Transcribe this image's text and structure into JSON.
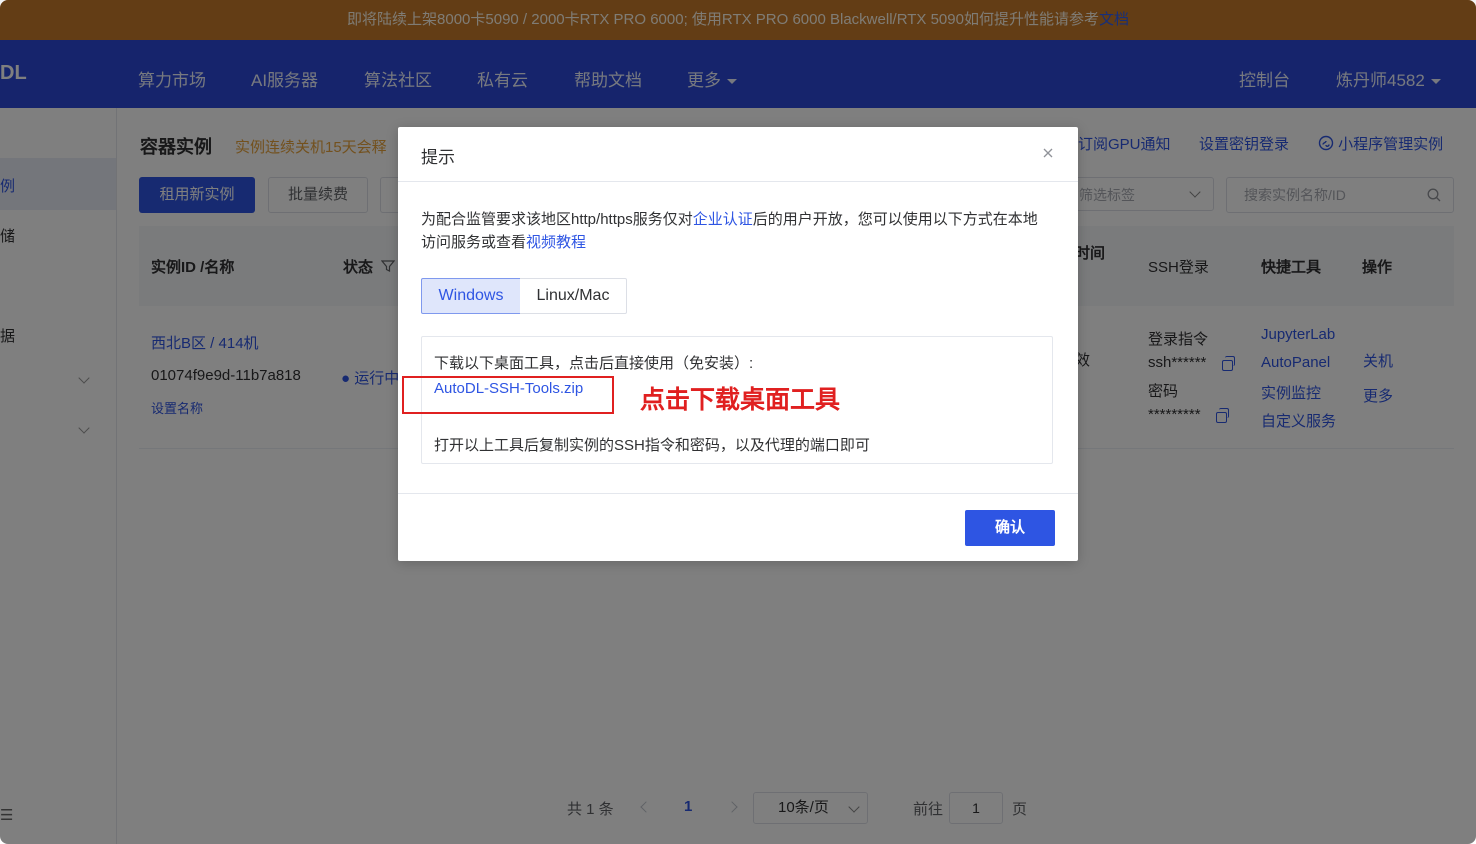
{
  "banner": {
    "text": "即将陆续上架8000卡5090 / 2000卡RTX PRO 6000; 使用RTX PRO 6000 Blackwell/RTX 5090如何提升性能请参考",
    "link": "文档"
  },
  "nav": {
    "logo": "DL",
    "items": [
      "算力市场",
      "AI服务器",
      "算法社区",
      "私有云",
      "帮助文档",
      "更多"
    ],
    "console": "控制台",
    "user": "炼丹师4582"
  },
  "sidebar": {
    "items": [
      "例",
      "储",
      "据",
      "☰"
    ]
  },
  "page": {
    "title": "容器实例",
    "note": "实例连续关机15天会释",
    "rent_button": "租用新实例",
    "renew_button": "批量续费",
    "subscribe_link": "订阅GPU通知",
    "key_link": "设置密钥登录",
    "miniprogram_link": "小程序管理实例",
    "filter_placeholder": "筛选标签",
    "search_placeholder": "搜索实例名称/ID"
  },
  "table": {
    "headers": {
      "id": "实例ID /名称",
      "status": "状态",
      "time": "时间",
      "ssh": "SSH登录",
      "tools": "快捷工具",
      "ops": "操作"
    },
    "row": {
      "region": "西北B区 / 414机",
      "id": "01074f9e9d-11b7a818",
      "set_name": "设置名称",
      "status": "运行中",
      "time_frag": "效",
      "ssh_cmd_label": "登录指令",
      "ssh_cmd": "ssh******",
      "pwd_label": "密码",
      "pwd": "*********",
      "tools": [
        "JupyterLab",
        "AutoPanel",
        "实例监控",
        "自定义服务"
      ],
      "ops": [
        "关机",
        "更多"
      ]
    }
  },
  "pagination": {
    "total": "共 1 条",
    "current": "1",
    "per_page": "10条/页",
    "goto_label": "前往",
    "goto_value": "1",
    "page_unit": "页"
  },
  "modal": {
    "title": "提示",
    "desc_before": "为配合监管要求该地区http/https服务仅对",
    "desc_link1": "企业认证",
    "desc_mid": "后的用户开放，您可以使用以下方式在本地访问服务或查看",
    "desc_link2": "视频教程",
    "tabs": [
      "Windows",
      "Linux/Mac"
    ],
    "line1": "下载以下桌面工具，点击后直接使用（免安装）:",
    "download_link": "AutoDL-SSH-Tools.zip",
    "line3": "打开以上工具后复制实例的SSH指令和密码，以及代理的端口即可",
    "callout": "点击下载桌面工具",
    "ok_button": "确认"
  },
  "colors": {
    "accent": "#2e55e3",
    "nav": "#2c49d8",
    "banner": "#c67a2a",
    "callout": "#e02020"
  }
}
